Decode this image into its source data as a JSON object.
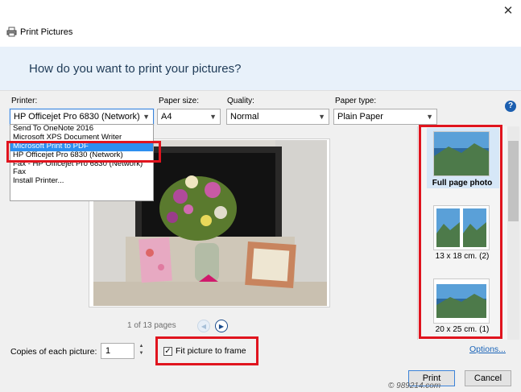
{
  "window": {
    "title": "Print Pictures",
    "close_icon": "close-icon"
  },
  "header": {
    "question": "How do you want to print your pictures?"
  },
  "controls": {
    "printer_label": "Printer:",
    "printer_value": "HP Officejet Pro 6830 (Network)",
    "paper_size_label": "Paper size:",
    "paper_size_value": "A4",
    "quality_label": "Quality:",
    "quality_value": "Normal",
    "paper_type_label": "Paper type:",
    "paper_type_value": "Plain Paper"
  },
  "printer_list": [
    "Send To OneNote 2016",
    "Microsoft XPS Document Writer",
    "Microsoft Print to PDF",
    "HP Officejet Pro 6830 (Network)",
    "Fax - HP Officejet Pro 6830 (Network)",
    "Fax",
    "Install Printer..."
  ],
  "printer_list_selected_index": 2,
  "preview": {
    "pages_label": "1 of 13 pages"
  },
  "layouts": [
    {
      "label": "Full page photo",
      "selected": true
    },
    {
      "label": "13 x 18 cm. (2)",
      "selected": false
    },
    {
      "label": "20 x 25 cm. (1)",
      "selected": false
    }
  ],
  "bottom": {
    "copies_label": "Copies of each picture:",
    "copies_value": "1",
    "fit_label": "Fit picture to frame",
    "fit_checked": true,
    "options_label": "Options...",
    "print_label": "Print",
    "cancel_label": "Cancel"
  },
  "watermark": "© 989214.com",
  "colors": {
    "highlight_red": "#e0141e",
    "selection_blue": "#2d8ff0",
    "header_band": "#e8f1fa"
  }
}
